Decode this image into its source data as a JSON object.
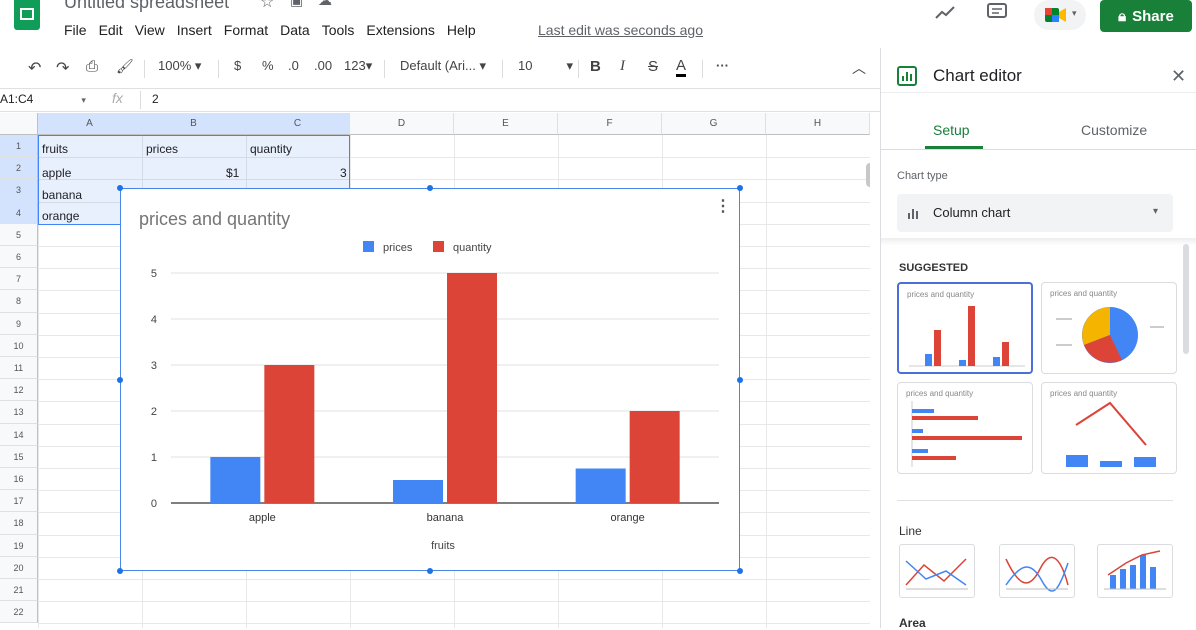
{
  "header": {
    "doc_title": "Untitled spreadsheet",
    "menu": [
      "File",
      "Edit",
      "View",
      "Insert",
      "Format",
      "Data",
      "Tools",
      "Extensions",
      "Help"
    ],
    "last_edit": "Last edit was seconds ago",
    "share_label": "Share"
  },
  "toolbar": {
    "zoom": "100%",
    "currency": "$",
    "percent": "%",
    "decrease_decimal": ".0",
    "increase_decimal": ".00",
    "number_format": "123",
    "font": "Default (Ari...",
    "font_size": "10",
    "bold": "B",
    "italic": "I",
    "strike": "S",
    "text_color": "A",
    "more": "···"
  },
  "formula_bar": {
    "name_box": "A1:C4",
    "fx": "fx",
    "value": "2"
  },
  "grid": {
    "columns": [
      "A",
      "B",
      "C",
      "D",
      "E",
      "F",
      "G",
      "H"
    ],
    "rows": [
      "1",
      "2",
      "3",
      "4",
      "5",
      "6",
      "7",
      "8",
      "9",
      "10",
      "11",
      "12",
      "13",
      "14",
      "15",
      "16",
      "17",
      "18",
      "19",
      "20",
      "21",
      "22"
    ],
    "cells": {
      "a1": "fruits",
      "b1": "prices",
      "c1": "quantity",
      "a2": "apple",
      "b2": "$1",
      "c2": "3",
      "a3": "banana",
      "a4": "orange"
    }
  },
  "chart_data": {
    "type": "bar",
    "title": "prices and quantity",
    "categories": [
      "apple",
      "banana",
      "orange"
    ],
    "series": [
      {
        "name": "prices",
        "values": [
          1,
          0.5,
          0.75
        ],
        "color": "#4285f4"
      },
      {
        "name": "quantity",
        "values": [
          3,
          5,
          2
        ],
        "color": "#db4437"
      }
    ],
    "xlabel": "fruits",
    "ylabel": "",
    "ylim": [
      0,
      5
    ],
    "yticks": [
      0,
      1,
      2,
      3,
      4,
      5
    ],
    "grid": true,
    "legend": "top"
  },
  "panel": {
    "title": "Chart editor",
    "tabs": [
      "Setup",
      "Customize"
    ],
    "active_tab": "Setup",
    "chart_type_label": "Chart type",
    "chart_type_value": "Column chart",
    "suggested_label": "SUGGESTED",
    "thumb_title": "prices and quantity",
    "line_label": "Line",
    "area_label": "Area"
  },
  "colors": {
    "share": "#188038",
    "accent": "#1a73e8",
    "prices": "#4285f4",
    "quantity": "#db4437",
    "pie_yellow": "#f4b400"
  }
}
